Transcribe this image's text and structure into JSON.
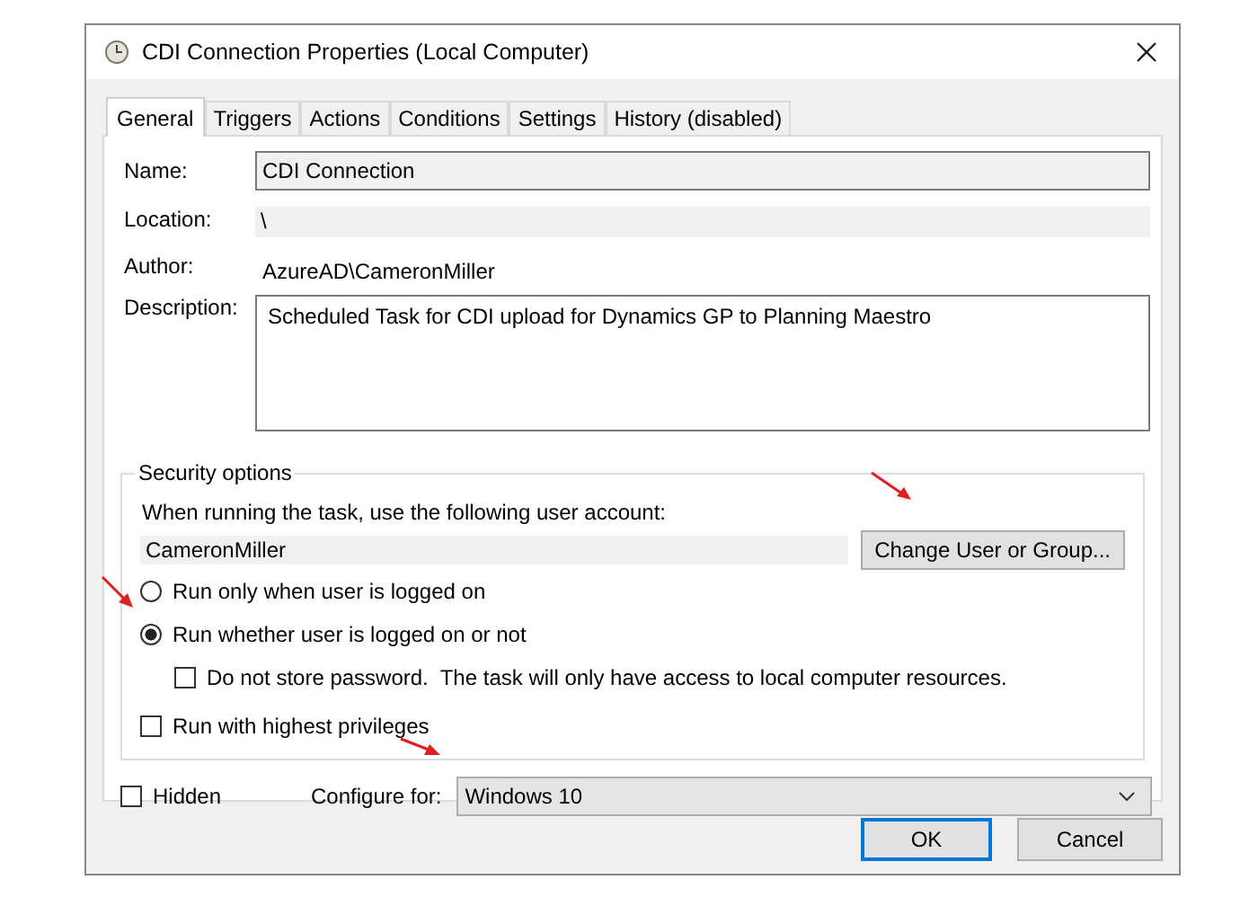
{
  "window": {
    "title": "CDI Connection Properties (Local Computer)"
  },
  "tabs": [
    {
      "label": "General",
      "selected": true
    },
    {
      "label": "Triggers",
      "selected": false
    },
    {
      "label": "Actions",
      "selected": false
    },
    {
      "label": "Conditions",
      "selected": false
    },
    {
      "label": "Settings",
      "selected": false
    },
    {
      "label": "History (disabled)",
      "selected": false
    }
  ],
  "general": {
    "name_label": "Name:",
    "name": "CDI Connection",
    "location_label": "Location:",
    "location": "\\",
    "author_label": "Author:",
    "author": "AzureAD\\CameronMiller",
    "description_label": "Description:",
    "description": "Scheduled Task for CDI upload for Dynamics GP to Planning Maestro"
  },
  "security": {
    "title": "Security options",
    "account_label": "When running the task, use the following user account:",
    "account": "CameronMiller",
    "change_button": "Change User or Group...",
    "run_options": [
      {
        "label": "Run only when user is logged on",
        "selected": false
      },
      {
        "label": "Run whether user is logged on or not",
        "selected": true
      }
    ],
    "do_not_store": {
      "label": "Do not store password.  The task will only have access to local computer resources.",
      "checked": false
    },
    "highest": {
      "label": "Run with highest privileges",
      "checked": false
    }
  },
  "hidden": {
    "label": "Hidden",
    "checked": false
  },
  "configure": {
    "label": "Configure for:",
    "value": "Windows 10"
  },
  "buttons": [
    {
      "label": "OK",
      "default": true
    },
    {
      "label": "Cancel",
      "default": false
    }
  ]
}
